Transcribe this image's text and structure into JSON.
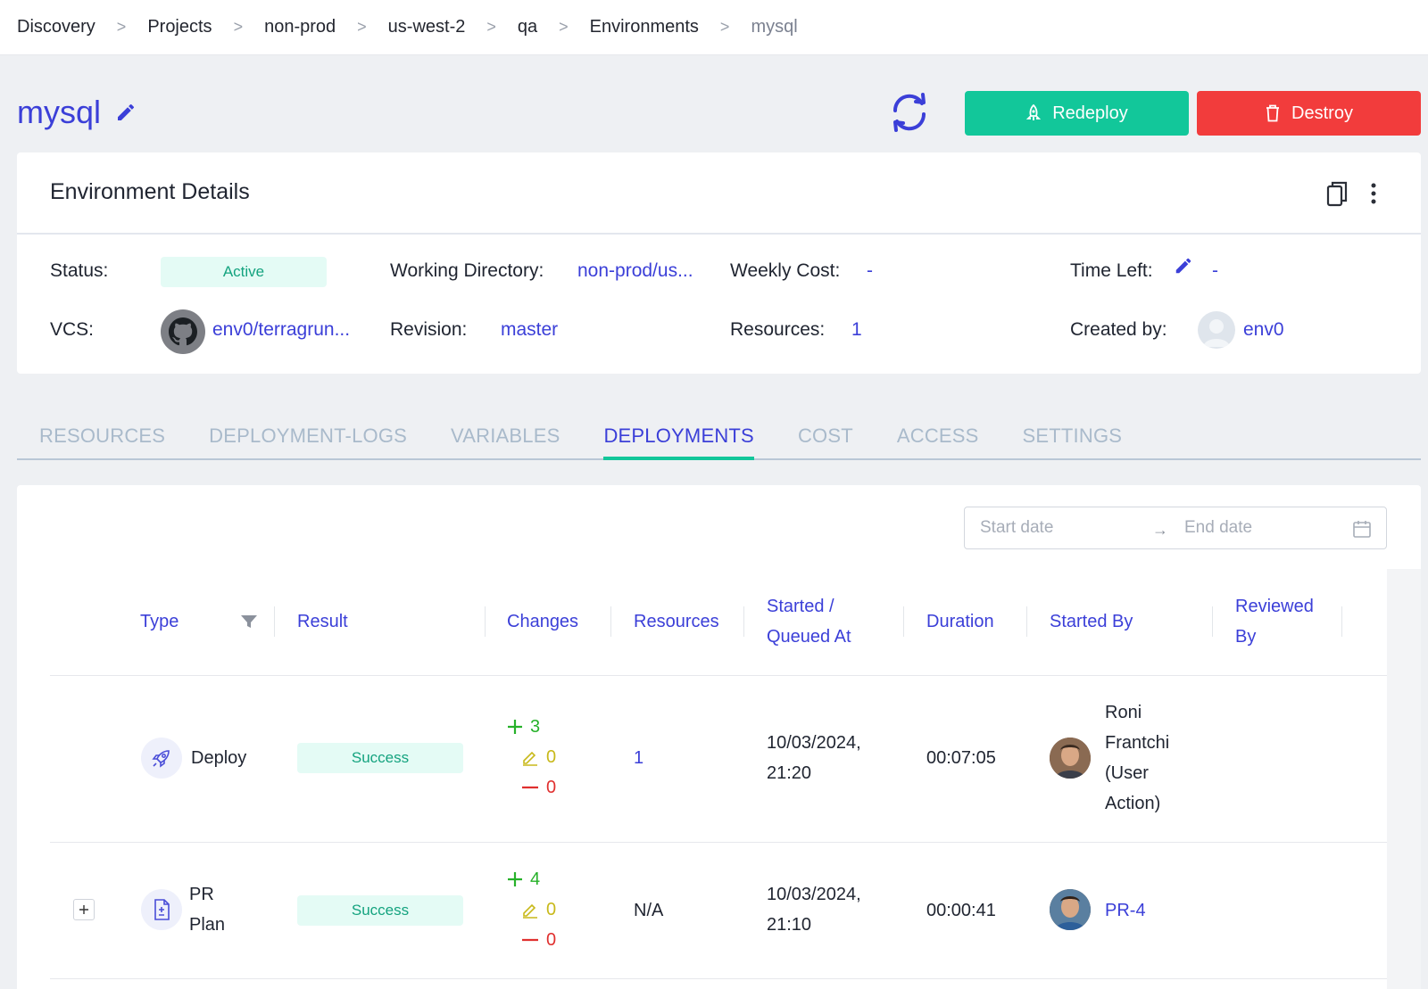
{
  "breadcrumb": [
    "Discovery",
    "Projects",
    "non-prod",
    "us-west-2",
    "qa",
    "Environments",
    "mysql"
  ],
  "breadcrumb_separator": ">",
  "header": {
    "title": "mysql",
    "redeploy_label": "Redeploy",
    "destroy_label": "Destroy"
  },
  "details": {
    "title": "Environment Details",
    "status_label": "Status:",
    "status_value": "Active",
    "working_dir_label": "Working Directory:",
    "working_dir_value": "non-prod/us...",
    "weekly_cost_label": "Weekly Cost:",
    "weekly_cost_value": "-",
    "time_left_label": "Time Left:",
    "time_left_value": "-",
    "vcs_label": "VCS:",
    "vcs_value": "env0/terragrun...",
    "revision_label": "Revision:",
    "revision_value": "master",
    "resources_label": "Resources:",
    "resources_value": "1",
    "created_by_label": "Created by:",
    "created_by_value": "env0"
  },
  "tabs": [
    "RESOURCES",
    "DEPLOYMENT-LOGS",
    "VARIABLES",
    "DEPLOYMENTS",
    "COST",
    "ACCESS",
    "SETTINGS"
  ],
  "active_tab": "DEPLOYMENTS",
  "date_range": {
    "start_placeholder": "Start date",
    "end_placeholder": "End date"
  },
  "table": {
    "columns": {
      "type": "Type",
      "result": "Result",
      "changes": "Changes",
      "resources": "Resources",
      "started_l1": "Started /",
      "started_l2": "Queued At",
      "duration": "Duration",
      "started_by": "Started By",
      "reviewed_l1": "Reviewed",
      "reviewed_l2": "By"
    },
    "rows": [
      {
        "type": "Deploy",
        "result": "Success",
        "added": "3",
        "changed": "0",
        "destroyed": "0",
        "resources": "1",
        "date": "10/03/2024,",
        "time": "21:20",
        "duration": "00:07:05",
        "started_by_lines": [
          "Roni",
          "Frantchi",
          "(User",
          "Action)"
        ],
        "reviewed_by": ""
      },
      {
        "type_l1": "PR",
        "type_l2": "Plan",
        "result": "Success",
        "added": "4",
        "changed": "0",
        "destroyed": "0",
        "resources": "N/A",
        "date": "10/03/2024,",
        "time": "21:10",
        "duration": "00:00:41",
        "started_by": "PR-4",
        "reviewed_by": ""
      }
    ]
  },
  "colors": {
    "accent": "#3b3fd8",
    "success": "#12c79a",
    "danger": "#f23c3c",
    "tab_inactive": "#a9bacb"
  }
}
